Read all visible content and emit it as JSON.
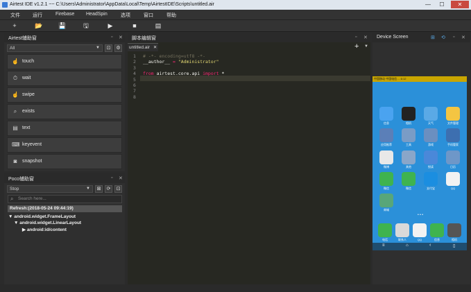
{
  "window": {
    "title": "Airtest IDE v1.2.1 ~~ C:\\Users\\Administrator\\AppData\\Local\\Temp\\AirtestIDE\\Scripts\\untitled.air",
    "controls": [
      "—",
      "☐",
      "✕"
    ]
  },
  "menu": [
    "文件",
    "运行",
    "Firebase",
    "HeadSpin",
    "选项",
    "窗口",
    "帮助"
  ],
  "toolbar": [
    "+",
    "📂",
    "💾",
    "🖫",
    "▶",
    "■",
    "▤"
  ],
  "airtest_panel": {
    "title": "Airtest辅助窗",
    "filter_value": "All",
    "apis": [
      {
        "label": "touch",
        "icon": "hand-icon",
        "glyph": "☝"
      },
      {
        "label": "wait",
        "icon": "clock-icon",
        "glyph": "⏱"
      },
      {
        "label": "swipe",
        "icon": "swipe-icon",
        "glyph": "☝"
      },
      {
        "label": "exists",
        "icon": "magnifier-icon",
        "glyph": "⌕"
      },
      {
        "label": "text",
        "icon": "text-icon",
        "glyph": "▤"
      },
      {
        "label": "keyevent",
        "icon": "keyboard-icon",
        "glyph": "⌨"
      },
      {
        "label": "snapshot",
        "icon": "camera-icon",
        "glyph": "◙"
      }
    ]
  },
  "poco_panel": {
    "title": "Poco辅助窗",
    "mode_value": "Stop",
    "search_placeholder": "Search here...",
    "refresh_text": "Refresh:(2018-05-24 09:44:19)",
    "tree": [
      {
        "label": "android.widget.FrameLayout",
        "depth": 0,
        "expanded": true
      },
      {
        "label": "android.widget.LinearLayout",
        "depth": 1,
        "expanded": true
      },
      {
        "label": "android:id/content",
        "depth": 2,
        "expanded": false
      }
    ]
  },
  "editor": {
    "title": "脚本编辑窗",
    "tab_label": "untitled.air",
    "lines": [
      {
        "n": "1",
        "parts": [
          {
            "t": "# -*- encoding=utf8 -*-",
            "c": "#75715e"
          }
        ]
      },
      {
        "n": "2",
        "parts": [
          {
            "t": "__author__",
            "c": "#f8f8f2"
          },
          {
            "t": " = ",
            "c": "#f92672"
          },
          {
            "t": "\"Administrator\"",
            "c": "#e6db74"
          }
        ]
      },
      {
        "n": "3",
        "parts": []
      },
      {
        "n": "4",
        "parts": [
          {
            "t": "from",
            "c": "#f92672"
          },
          {
            "t": " airtest.core.api ",
            "c": "#f8f8f2"
          },
          {
            "t": "import",
            "c": "#f92672"
          },
          {
            "t": " *",
            "c": "#f8f8f2"
          }
        ]
      },
      {
        "n": "5",
        "parts": []
      },
      {
        "n": "6",
        "parts": []
      },
      {
        "n": "7",
        "parts": []
      },
      {
        "n": "8",
        "parts": []
      }
    ]
  },
  "device": {
    "title": "Device Screen",
    "statusbar": "中国移动 中国电信 ... 6:12",
    "apps": [
      {
        "label": "信息",
        "color": "#4aa3f0"
      },
      {
        "label": "相机",
        "color": "#222222"
      },
      {
        "label": "天气",
        "color": "#5aa9e6"
      },
      {
        "label": "文件管理",
        "color": "#f4c542"
      },
      {
        "label": "应用推荐",
        "color": "#5b7fb8"
      },
      {
        "label": "工具",
        "color": "#7a9cc6"
      },
      {
        "label": "游戏",
        "color": "#6b8fc0"
      },
      {
        "label": "手机管家",
        "color": "#3d6fb0"
      },
      {
        "label": "微博",
        "color": "#e8e8e8"
      },
      {
        "label": "其他",
        "color": "#8aa6c9"
      },
      {
        "label": "悦读",
        "color": "#4a88d9"
      },
      {
        "label": "日历",
        "color": "#6e97c8"
      },
      {
        "label": "微信",
        "color": "#3fb34f"
      },
      {
        "label": "微信",
        "color": "#3fb34f"
      },
      {
        "label": "支付宝",
        "color": "#1b8ee0"
      },
      {
        "label": "QQ",
        "color": "#f2f2f2"
      },
      {
        "label": "商城",
        "color": "#58a67a"
      }
    ],
    "dock": [
      {
        "label": "电话",
        "color": "#3fb34f"
      },
      {
        "label": "联系人",
        "color": "#d9d9d9"
      },
      {
        "label": "QQ",
        "color": "#f2f2f2"
      },
      {
        "label": "信息",
        "color": "#3fb34f"
      },
      {
        "label": "相机",
        "color": "#555555"
      }
    ],
    "nav": [
      "≡",
      "⌂",
      "‹",
      "▯"
    ]
  }
}
